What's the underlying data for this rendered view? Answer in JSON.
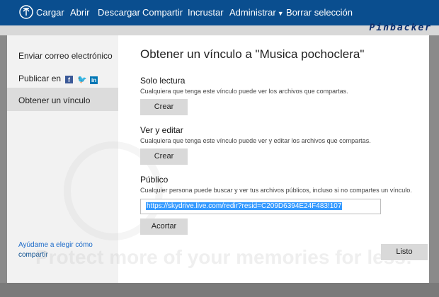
{
  "toolbar": {
    "upload_icon": "upload-arrow-icon",
    "items": [
      "Cargar",
      "Abrir",
      "Descargar",
      "Compartir",
      "Incrustar",
      "Administrar",
      "Borrar selección"
    ],
    "admin_chevron": "chevron-down-icon"
  },
  "watermark": {
    "brand": "Pinbacker",
    "overlay_text": "Protect more of your memories for less!"
  },
  "sidebar": {
    "email": "Enviar correo electrónico",
    "publish": "Publicar en",
    "publish_icons": [
      "facebook-icon",
      "twitter-icon",
      "linkedin-icon"
    ],
    "get_link": "Obtener un vínculo",
    "help_line1": "Ayúdame a elegir cómo",
    "help_line2": "compartir"
  },
  "dialog": {
    "title": "Obtener un vínculo a \"Musica pochoclera\"",
    "read_only": {
      "title": "Solo lectura",
      "desc": "Cualquiera que tenga este vínculo puede ver los archivos que compartas.",
      "button": "Crear"
    },
    "view_edit": {
      "title": "Ver y editar",
      "desc": "Cualquiera que tenga este vínculo puede ver y editar los archivos que compartas.",
      "button": "Crear"
    },
    "public": {
      "title": "Público",
      "desc": "Cualquier persona puede buscar y ver tus archivos públicos, incluso si no compartes un vínculo.",
      "link": "https://skydrive.live.com/redir?resid=C209D6394E24F483!107",
      "shorten_button": "Acortar"
    },
    "done_button": "Listo"
  }
}
